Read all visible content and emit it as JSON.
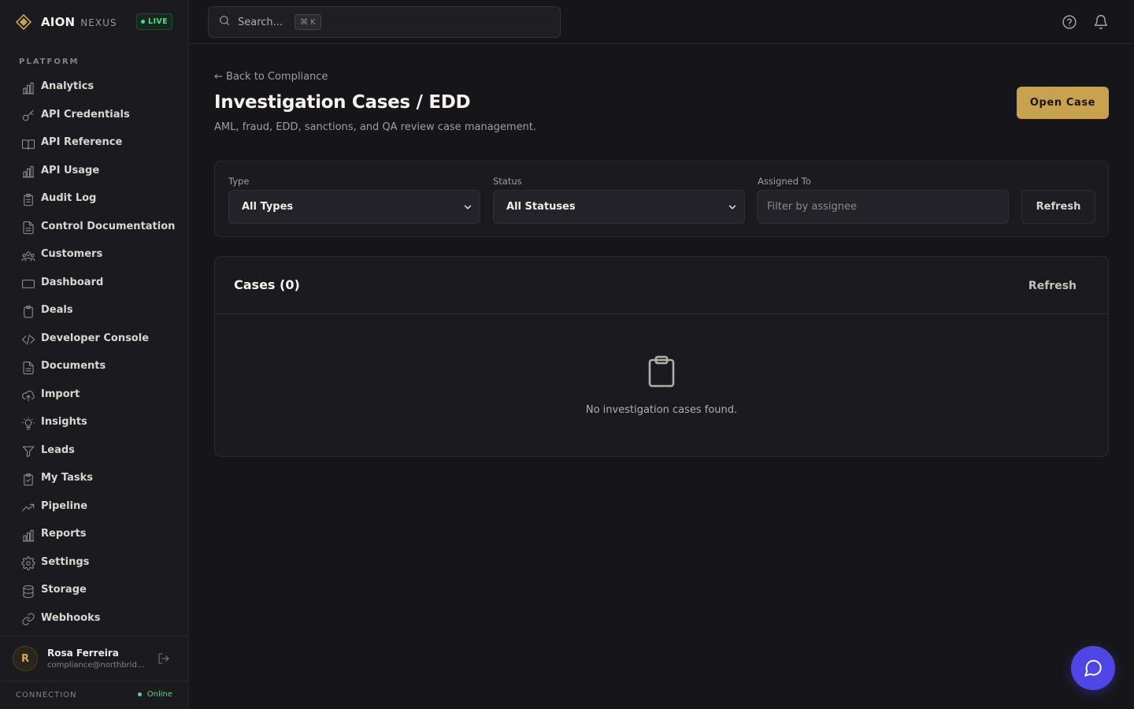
{
  "brand": {
    "name": "AION",
    "sub": "NEXUS",
    "badge": "LIVE"
  },
  "sidebar": {
    "section_label": "PLATFORM",
    "items": [
      {
        "label": "Analytics",
        "icon": "bar-chart-icon"
      },
      {
        "label": "API Credentials",
        "icon": "key-icon"
      },
      {
        "label": "API Reference",
        "icon": "book-icon"
      },
      {
        "label": "API Usage",
        "icon": "bar-chart-icon"
      },
      {
        "label": "Audit Log",
        "icon": "clipboard-list-icon"
      },
      {
        "label": "Control Documentation",
        "icon": "document-icon"
      },
      {
        "label": "Customers",
        "icon": "users-icon"
      },
      {
        "label": "Dashboard",
        "icon": "monitor-icon"
      },
      {
        "label": "Deals",
        "icon": "clipboard-icon"
      },
      {
        "label": "Developer Console",
        "icon": "code-icon"
      },
      {
        "label": "Documents",
        "icon": "document-icon"
      },
      {
        "label": "Import",
        "icon": "cloud-upload-icon"
      },
      {
        "label": "Insights",
        "icon": "lightbulb-icon"
      },
      {
        "label": "Leads",
        "icon": "funnel-icon"
      },
      {
        "label": "My Tasks",
        "icon": "clipboard-check-icon"
      },
      {
        "label": "Pipeline",
        "icon": "trending-up-icon"
      },
      {
        "label": "Reports",
        "icon": "bar-chart-icon"
      },
      {
        "label": "Settings",
        "icon": "gear-icon"
      },
      {
        "label": "Storage",
        "icon": "database-icon"
      },
      {
        "label": "Webhooks",
        "icon": "link-icon"
      }
    ]
  },
  "user": {
    "initial": "R",
    "name": "Rosa Ferreira",
    "email": "compliance@northbridge.com"
  },
  "connection": {
    "label": "CONNECTION",
    "status": "Online"
  },
  "topbar": {
    "search_placeholder": "Search...",
    "shortcut": "⌘ K"
  },
  "page": {
    "back_link": "← Back to Compliance",
    "title": "Investigation Cases / EDD",
    "subtitle": "AML, fraud, EDD, sanctions, and QA review case management.",
    "primary_button": "Open Case"
  },
  "filters": {
    "type_label": "Type",
    "type_value": "All Types",
    "status_label": "Status",
    "status_value": "All Statuses",
    "assigned_label": "Assigned To",
    "assigned_placeholder": "Filter by assignee",
    "refresh_label": "Refresh"
  },
  "cases": {
    "title": "Cases (0)",
    "refresh_label": "Refresh",
    "empty_text": "No investigation cases found."
  },
  "colors": {
    "accent": "#c9a24f",
    "live": "#4ade80",
    "chat": "#4f46e5"
  }
}
